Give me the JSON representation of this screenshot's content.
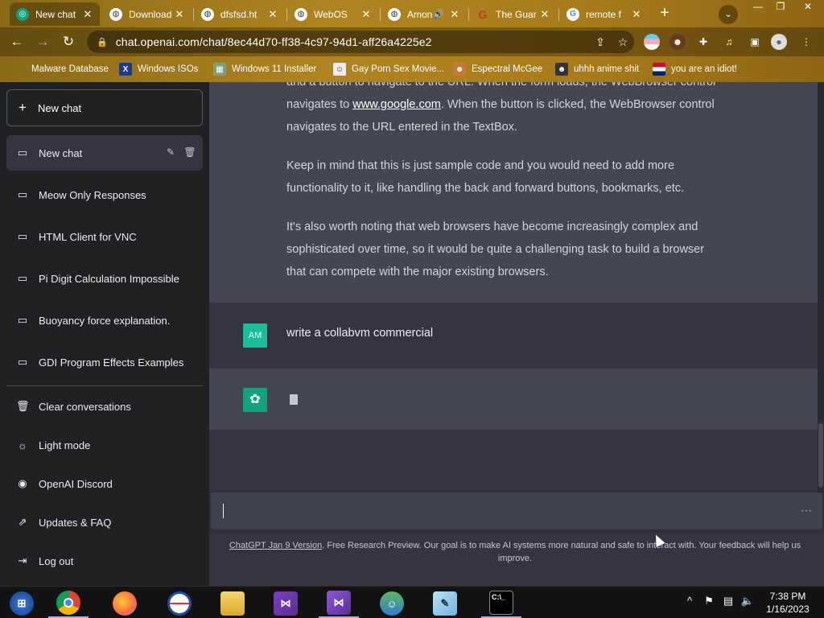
{
  "browser": {
    "tabs": [
      {
        "title": "New chat",
        "favicon": "chatgpt-icon",
        "color": "#10a37f",
        "active": true
      },
      {
        "title": "Download",
        "favicon": "globe-icon",
        "color": "#ffffff",
        "active": false
      },
      {
        "title": "dfsfsd.ht",
        "favicon": "globe-icon",
        "color": "#ffffff",
        "active": false
      },
      {
        "title": "WebOS",
        "favicon": "globe-icon",
        "color": "#ffffff",
        "active": false
      },
      {
        "title": "Amon",
        "favicon": "globe-icon",
        "color": "#ffffff",
        "active": false,
        "audio": "speaker-icon"
      },
      {
        "title": "The Guar",
        "favicon": "guardian-icon",
        "color": "#c0392b",
        "active": false
      },
      {
        "title": "remote f",
        "favicon": "google-icon",
        "color": "#ffffff",
        "active": false
      }
    ],
    "new_tab": "+",
    "tab_search": "⌄",
    "window_controls": {
      "minimize": "—",
      "restore": "❐",
      "close": "✕"
    },
    "url": "chat.openai.com/chat/8ec44d70-ff38-4c97-94d1-aff26a4225e2",
    "bookmarks": [
      {
        "label": "Malware Database",
        "icon": "bookmark-icon"
      },
      {
        "label": "Windows ISOs",
        "icon": "x-logo-icon"
      },
      {
        "label": "Windows 11 Installer",
        "icon": "image-icon"
      },
      {
        "label": "Gay Porn Sex Movie...",
        "icon": "face-icon"
      },
      {
        "label": "Espectral McGee",
        "icon": "face-icon"
      },
      {
        "label": "uhhh anime shit",
        "icon": "face-icon"
      },
      {
        "label": "you are an idiot!",
        "icon": "flag-icon"
      }
    ]
  },
  "sidebar": {
    "new_chat_button": "New chat",
    "active_chat": "New chat",
    "history": [
      "Meow Only Responses",
      "HTML Client for VNC",
      "Pi Digit Calculation Impossible",
      "Buoyancy force explanation.",
      "GDI Program Effects Examples"
    ],
    "actions": [
      {
        "label": "Clear conversations",
        "icon": "trash-icon"
      },
      {
        "label": "Light mode",
        "icon": "sun-icon"
      },
      {
        "label": "OpenAI Discord",
        "icon": "discord-icon"
      },
      {
        "label": "Updates & FAQ",
        "icon": "external-link-icon"
      },
      {
        "label": "Log out",
        "icon": "logout-icon"
      }
    ]
  },
  "conversation": {
    "assistant_paragraph_1_prefix": "and a button to navigate to the URL. When the form loads, the WebBrowser control navigates to ",
    "assistant_paragraph_1_link": "www.google.com",
    "assistant_paragraph_1_suffix": ". When the button is clicked, the WebBrowser control navigates to the URL entered in the TextBox.",
    "assistant_paragraph_2": "Keep in mind that this is just sample code and you would need to add more functionality to it, like handling the back and forward buttons, bookmarks, etc.",
    "assistant_paragraph_3": "It's also worth noting that web browsers have become increasingly complex and sophisticated over time, so it would be quite a challenging task to build a browser that can compete with the major existing browsers.",
    "user_initials": "AM",
    "user_message": "write a collabvm commercial",
    "user_avatar_color": "#1abc9c",
    "assistant_avatar_color": "#10a37f"
  },
  "composer": {
    "more_icon": "⋯"
  },
  "footer": {
    "version_link": "ChatGPT Jan 9 Version",
    "text": ". Free Research Preview. Our goal is to make AI systems more natural and safe to interact with. Your feedback will help us improve."
  },
  "taskbar": {
    "apps": [
      "windows-start-icon",
      "chrome-icon",
      "firefox-icon",
      "obama-icon",
      "file-explorer-icon",
      "visual-studio-installer-icon",
      "visual-studio-icon",
      "people-icon",
      "notepad-icon",
      "terminal-icon"
    ],
    "time": "7:38 PM",
    "date": "1/16/2023"
  }
}
